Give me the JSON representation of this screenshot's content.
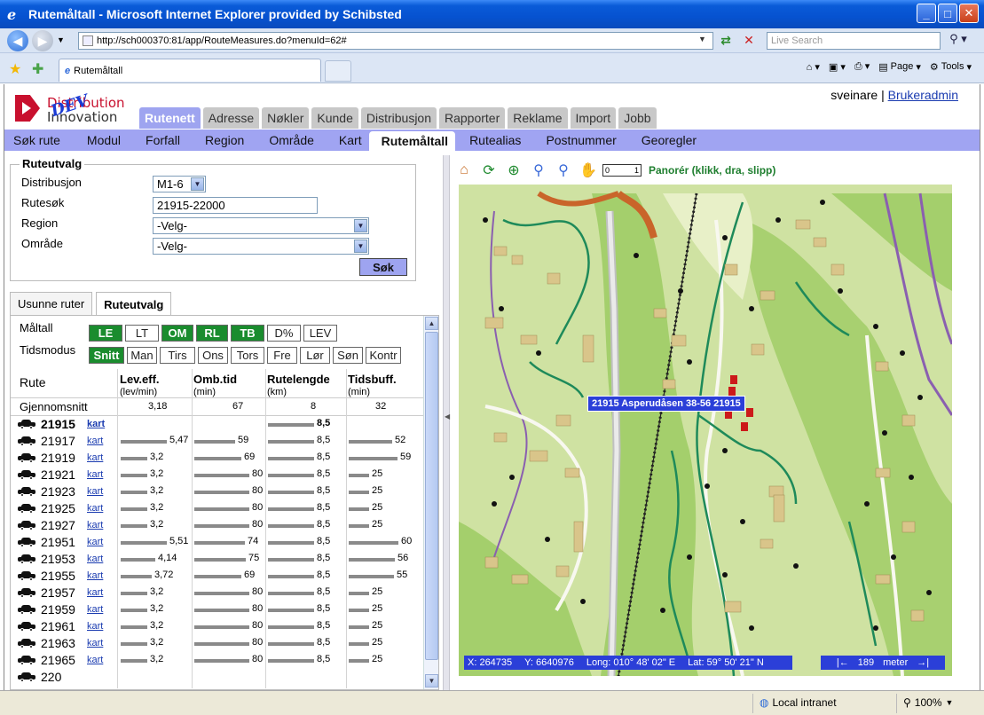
{
  "window": {
    "title": "Rutemåltall - Microsoft Internet Explorer provided by Schibsted",
    "address": "http://sch000370:81/app/RouteMeasures.do?menuId=62#",
    "search_placeholder": "Live Search",
    "tab_title": "Rutemåltall",
    "cmd_page": "Page",
    "cmd_tools": "Tools"
  },
  "header": {
    "logo_line1": "Distribution",
    "logo_line2": "Innovation",
    "logo_badge": "DEV",
    "user": "sveinare",
    "separator": "|",
    "admin_link": "Brukeradmin"
  },
  "main_tabs": [
    "Rutenett",
    "Adresse",
    "Nøkler",
    "Kunde",
    "Distribusjon",
    "Rapporter",
    "Reklame",
    "Import",
    "Jobb"
  ],
  "sub_nav": [
    "Søk rute",
    "Modul",
    "Forfall",
    "Region",
    "Område",
    "Kart",
    "Rutemåltall",
    "Rutealias",
    "Postnummer",
    "Georegler"
  ],
  "form": {
    "legend": "Ruteutvalg",
    "distribusjon_label": "Distribusjon",
    "distribusjon_value": "M1-6",
    "rutesok_label": "Rutesøk",
    "rutesok_value": "21915-22000",
    "region_label": "Region",
    "region_value": "-Velg-",
    "omrade_label": "Område",
    "omrade_value": "-Velg-",
    "sok_button": "Søk"
  },
  "lower_tabs": [
    "Usunne ruter",
    "Ruteutvalg"
  ],
  "measures": {
    "maltall_label": "Måltall",
    "maltall_buttons": [
      {
        "label": "LE",
        "on": true
      },
      {
        "label": "LT",
        "on": false
      },
      {
        "label": "OM",
        "on": true
      },
      {
        "label": "RL",
        "on": true
      },
      {
        "label": "TB",
        "on": true
      },
      {
        "label": "D%",
        "on": false
      },
      {
        "label": "LEV",
        "on": false
      }
    ],
    "tidsmodus_label": "Tidsmodus",
    "tidsmodus_buttons": [
      {
        "label": "Snitt",
        "on": true
      },
      {
        "label": "Man",
        "on": false
      },
      {
        "label": "Tirs",
        "on": false
      },
      {
        "label": "Ons",
        "on": false
      },
      {
        "label": "Tors",
        "on": false
      },
      {
        "label": "Fre",
        "on": false
      },
      {
        "label": "Lør",
        "on": false
      },
      {
        "label": "Søn",
        "on": false
      },
      {
        "label": "Kontr",
        "on": false
      }
    ]
  },
  "table": {
    "col_rute": "Rute",
    "columns": [
      {
        "title": "Lev.eff.",
        "unit": "(lev/min)"
      },
      {
        "title": "Omb.tid",
        "unit": "(min)"
      },
      {
        "title": "Rutelengde",
        "unit": "(km)"
      },
      {
        "title": "Tidsbuff.",
        "unit": "(min)"
      }
    ],
    "average_label": "Gjennomsnitt",
    "average": [
      "3,18",
      "67",
      "8",
      "32"
    ],
    "kart_label": "kart",
    "rows": [
      {
        "id": "21915",
        "bold": true,
        "kart": true,
        "v": [
          "",
          "",
          "8,5",
          ""
        ],
        "n": [
          0,
          0,
          8.5,
          0
        ]
      },
      {
        "id": "21917",
        "kart": true,
        "v": [
          "5,47",
          "59",
          "8,5",
          "52"
        ],
        "n": [
          5.47,
          59,
          8.5,
          52
        ]
      },
      {
        "id": "21919",
        "kart": true,
        "v": [
          "3,2",
          "69",
          "8,5",
          "59"
        ],
        "n": [
          3.2,
          69,
          8.5,
          59
        ]
      },
      {
        "id": "21921",
        "kart": true,
        "v": [
          "3,2",
          "80",
          "8,5",
          "25"
        ],
        "n": [
          3.2,
          80,
          8.5,
          25
        ]
      },
      {
        "id": "21923",
        "kart": true,
        "v": [
          "3,2",
          "80",
          "8,5",
          "25"
        ],
        "n": [
          3.2,
          80,
          8.5,
          25
        ]
      },
      {
        "id": "21925",
        "kart": true,
        "v": [
          "3,2",
          "80",
          "8,5",
          "25"
        ],
        "n": [
          3.2,
          80,
          8.5,
          25
        ]
      },
      {
        "id": "21927",
        "kart": true,
        "v": [
          "3,2",
          "80",
          "8,5",
          "25"
        ],
        "n": [
          3.2,
          80,
          8.5,
          25
        ]
      },
      {
        "id": "21951",
        "kart": true,
        "v": [
          "5,51",
          "74",
          "8,5",
          "60"
        ],
        "n": [
          5.51,
          74,
          8.5,
          60
        ]
      },
      {
        "id": "21953",
        "kart": true,
        "v": [
          "4,14",
          "75",
          "8,5",
          "56"
        ],
        "n": [
          4.14,
          75,
          8.5,
          56
        ]
      },
      {
        "id": "21955",
        "kart": true,
        "v": [
          "3,72",
          "69",
          "8,5",
          "55"
        ],
        "n": [
          3.72,
          69,
          8.5,
          55
        ]
      },
      {
        "id": "21957",
        "kart": true,
        "v": [
          "3,2",
          "80",
          "8,5",
          "25"
        ],
        "n": [
          3.2,
          80,
          8.5,
          25
        ]
      },
      {
        "id": "21959",
        "kart": true,
        "v": [
          "3,2",
          "80",
          "8,5",
          "25"
        ],
        "n": [
          3.2,
          80,
          8.5,
          25
        ]
      },
      {
        "id": "21961",
        "kart": true,
        "v": [
          "3,2",
          "80",
          "8,5",
          "25"
        ],
        "n": [
          3.2,
          80,
          8.5,
          25
        ]
      },
      {
        "id": "21963",
        "kart": true,
        "v": [
          "3,2",
          "80",
          "8,5",
          "25"
        ],
        "n": [
          3.2,
          80,
          8.5,
          25
        ]
      },
      {
        "id": "21965",
        "kart": true,
        "v": [
          "3,2",
          "80",
          "8,5",
          "25"
        ],
        "n": [
          3.2,
          80,
          8.5,
          25
        ]
      },
      {
        "id": "220",
        "kart": false,
        "v": [
          "",
          "",
          "",
          ""
        ],
        "n": [
          0,
          0,
          0,
          0
        ]
      }
    ]
  },
  "map": {
    "pan_hint": "Panorér (klikk, dra, slipp)",
    "route_label": "21915 Asperudåsen 38-56 21915",
    "coord_x": "X: 264735",
    "coord_y": "Y: 6640976",
    "coord_long": "Long:  010° 48' 02\" E",
    "coord_lat": "Lat:  59° 50' 21\" N",
    "scale_value": "189",
    "scale_unit": "meter"
  },
  "status": {
    "zone": "Local intranet",
    "zoom": "100%"
  }
}
